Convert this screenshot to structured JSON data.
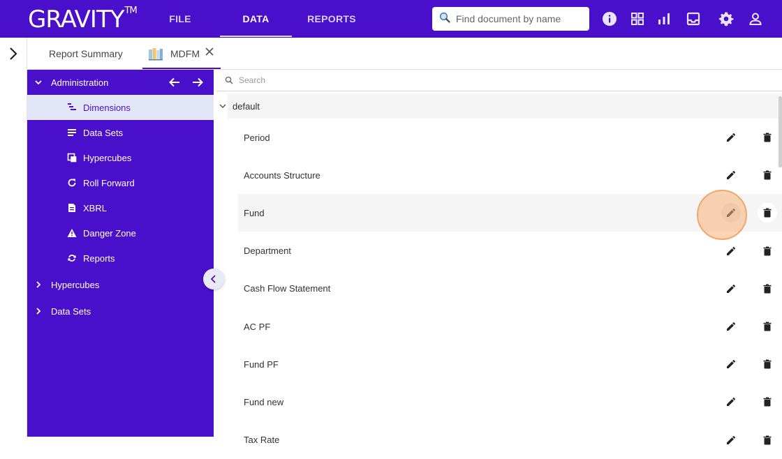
{
  "app": {
    "logo_text": "GRAVITY",
    "logo_tm": "TM"
  },
  "topnav": {
    "items": [
      {
        "label": "FILE"
      },
      {
        "label": "DATA"
      },
      {
        "label": "REPORTS"
      }
    ],
    "active": "DATA"
  },
  "search": {
    "placeholder": "Find document by name",
    "value": ""
  },
  "toolbar_icons": [
    "info-icon",
    "apps-grid-icon",
    "bar-chart-icon",
    "inbox-icon",
    "gear-icon",
    "user-icon"
  ],
  "tabs": [
    {
      "label": "Report Summary"
    },
    {
      "label": "MDFM",
      "active": true,
      "closable": true
    }
  ],
  "sidebar": {
    "root": {
      "label": "Administration",
      "expanded": true
    },
    "children": [
      {
        "label": "Dimensions",
        "icon": "sort-lines-icon",
        "selected": true
      },
      {
        "label": "Data Sets",
        "icon": "list-icon"
      },
      {
        "label": "Hypercubes",
        "icon": "hypercube-icon"
      },
      {
        "label": "Roll Forward",
        "icon": "refresh-icon"
      },
      {
        "label": "XBRL",
        "icon": "document-icon"
      },
      {
        "label": "Danger Zone",
        "icon": "warning-icon"
      },
      {
        "label": "Reports",
        "icon": "sync-icon"
      }
    ],
    "groups": [
      {
        "label": "Hypercubes",
        "expanded": false
      },
      {
        "label": "Data Sets",
        "expanded": false
      }
    ]
  },
  "content": {
    "search_placeholder": "Search",
    "group": {
      "label": "default",
      "expanded": true
    },
    "items": [
      {
        "label": "Period"
      },
      {
        "label": "Accounts Structure"
      },
      {
        "label": "Fund",
        "hover": true
      },
      {
        "label": "Department"
      },
      {
        "label": "Cash Flow Statement"
      },
      {
        "label": "AC PF"
      },
      {
        "label": "Fund PF"
      },
      {
        "label": "Fund new"
      },
      {
        "label": "Tax Rate"
      }
    ]
  },
  "colors": {
    "brand": "#4a0fcb",
    "selected_bg": "#e3e6f6",
    "hover_row": "#f5f5f5"
  }
}
